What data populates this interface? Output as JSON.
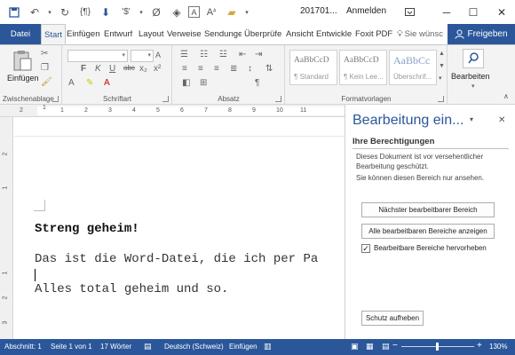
{
  "titlebar": {
    "title": "201701...",
    "sign_in": "Anmelden"
  },
  "tabs": {
    "file": "Datei",
    "items": [
      "Start",
      "Einfügen",
      "Entwurf",
      "Layout",
      "Verweise",
      "Sendunge",
      "Überprüfe",
      "Ansicht",
      "Entwickle",
      "Foxit PDF"
    ],
    "tell_me": "Sie wünsc",
    "share": "Freigeben"
  },
  "ribbon": {
    "clipboard_label": "Zwischenablage",
    "paste_label": "Einfügen",
    "font_label": "Schriftart",
    "paragraph_label": "Absatz",
    "styles_label": "Formatvorlagen",
    "styles": [
      {
        "sample": "AaBbCcD",
        "name": "¶ Standard"
      },
      {
        "sample": "AaBbCcD",
        "name": "¶ Kein Lee..."
      },
      {
        "sample": "AaBbCc",
        "name": "Überschrif..."
      }
    ],
    "editing_label": "Bearbeiten",
    "font_format_glyphs": [
      "F",
      "K",
      "U",
      "abc",
      "x₂",
      "x²"
    ]
  },
  "ruler": {
    "h_ticks": [
      "1",
      "2",
      "1",
      "2",
      "3",
      "4",
      "5",
      "6",
      "7",
      "8",
      "9",
      "10",
      "11"
    ],
    "v_ticks": [
      "2",
      "1",
      "1",
      "2",
      "3"
    ]
  },
  "document": {
    "lines": [
      "Streng geheim!",
      "Das ist die Word-Datei, die ich per Pa",
      "Alles total geheim und so."
    ]
  },
  "pane": {
    "title": "Bearbeitung ein...",
    "subtitle": "Ihre Berechtigungen",
    "description": "Dieses Dokument ist vor versehentlicher Bearbeitung geschützt.",
    "view_only": "Sie können diesen Bereich nur ansehen.",
    "next_region_button": "Nächster bearbeitbarer Bereich",
    "show_all_button": "Alle bearbeitbaren Bereiche anzeigen",
    "highlight_checkbox": "Bearbeitbare Bereiche hervorheben",
    "highlight_checked": true,
    "unprotect_button": "Schutz aufheben"
  },
  "status": {
    "section": "Abschnitt: 1",
    "page": "Seite 1 von 1",
    "words": "17 Wörter",
    "language": "Deutsch (Schweiz)",
    "mode": "Einfügen",
    "zoom": "130%"
  },
  "colors": {
    "accent": "#2b579a",
    "ribbon": "#f3f3f3"
  }
}
